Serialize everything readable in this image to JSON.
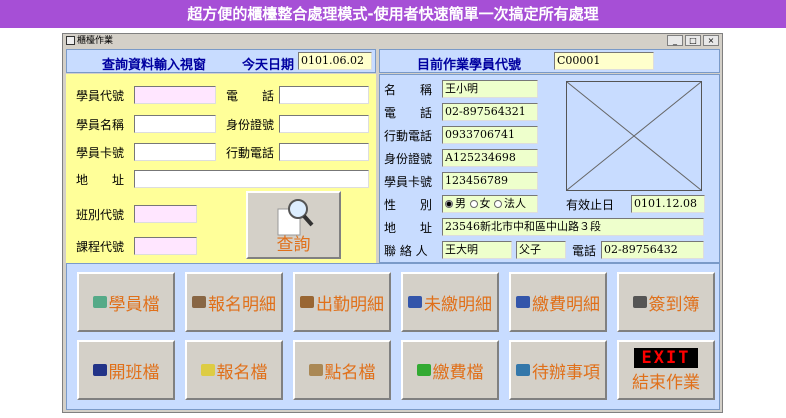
{
  "banner": "超方便的櫃檯整合處理模式-使用者快速簡單一次搞定所有處理",
  "window": {
    "title": "櫃檯作業",
    "min": "_",
    "max": "□",
    "close": "×"
  },
  "query": {
    "header": "查詢資料輸入視窗",
    "today_label": "今天日期",
    "today_value": "0101.06.02",
    "labels": {
      "student_id": "學員代號",
      "phone": "電　　話",
      "student_name": "學員名稱",
      "id_number": "身份證號",
      "card_no": "學員卡號",
      "mobile": "行動電話",
      "address": "地　　址",
      "class_code": "班別代號",
      "course_code": "課程代號"
    },
    "search_button": "查詢"
  },
  "current": {
    "header": "目前作業學員代號",
    "student_code": "C00001",
    "labels": {
      "name": "名　　稱",
      "phone": "電　　話",
      "mobile": "行動電話",
      "id_number": "身份證號",
      "card_no": "學員卡號",
      "gender": "性　　別",
      "address": "地　　址",
      "contact": "聯 絡 人",
      "expiry": "有效止日",
      "contact_phone": "電話"
    },
    "values": {
      "name": "王小明",
      "phone": "02-897564321",
      "mobile": "0933706741",
      "id_number": "A125234698",
      "card_no": "123456789",
      "address": "23546新北市中和區中山路３段",
      "contact": "王大明",
      "relation": "父子",
      "contact_phone": "02-89756432",
      "expiry": "0101.12.08"
    },
    "gender_options": [
      "男",
      "女",
      "法人"
    ],
    "gender_selected": "男"
  },
  "buttons": {
    "row1": [
      "學員檔",
      "報名明細",
      "出勤明細",
      "未繳明細",
      "繳費明細",
      "簽到簿"
    ],
    "row2": [
      "開班檔",
      "報名檔",
      "點名檔",
      "繳費檔",
      "待辦事項"
    ],
    "exit_badge": "EXIT",
    "exit_label": "結束作業"
  }
}
